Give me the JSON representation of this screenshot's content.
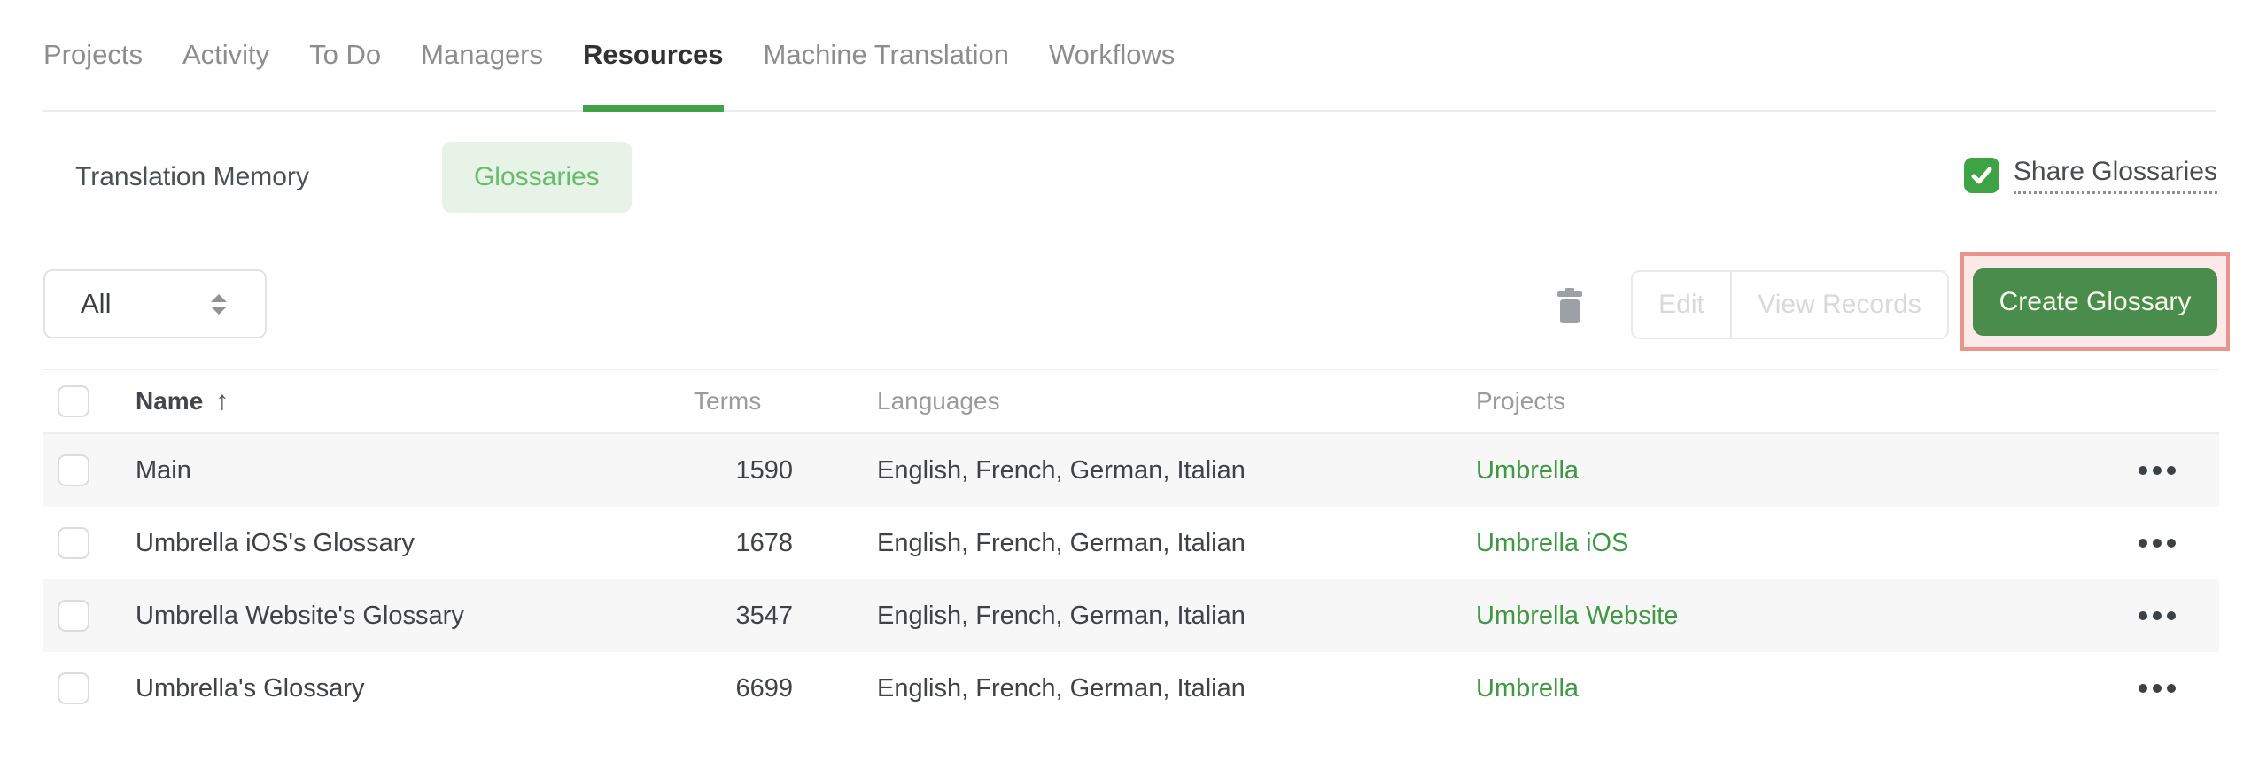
{
  "nav": {
    "tabs": [
      {
        "label": "Projects",
        "active": false
      },
      {
        "label": "Activity",
        "active": false
      },
      {
        "label": "To Do",
        "active": false
      },
      {
        "label": "Managers",
        "active": false
      },
      {
        "label": "Resources",
        "active": true
      },
      {
        "label": "Machine Translation",
        "active": false
      },
      {
        "label": "Workflows",
        "active": false
      }
    ]
  },
  "subtabs": {
    "translation_memory": "Translation Memory",
    "glossaries": "Glossaries"
  },
  "share": {
    "label": "Share Glossaries",
    "checked": true
  },
  "toolbar": {
    "filter_value": "All",
    "edit_label": "Edit",
    "view_records_label": "View Records",
    "create_label": "Create Glossary"
  },
  "icons": {
    "sort_ascending": "↑"
  },
  "table": {
    "header": {
      "name": "Name",
      "terms": "Terms",
      "languages": "Languages",
      "projects": "Projects"
    },
    "rows": [
      {
        "name": "Main",
        "terms": "1590",
        "languages": "English, French, German, Italian",
        "project": "Umbrella"
      },
      {
        "name": "Umbrella iOS's Glossary",
        "terms": "1678",
        "languages": "English, French, German, Italian",
        "project": "Umbrella iOS"
      },
      {
        "name": "Umbrella Website's Glossary",
        "terms": "3547",
        "languages": "English, French, German, Italian",
        "project": "Umbrella Website"
      },
      {
        "name": "Umbrella's Glossary",
        "terms": "6699",
        "languages": "English, French, German, Italian",
        "project": "Umbrella"
      }
    ]
  },
  "colors": {
    "accent-green": "#42a246",
    "check-green": "#3da345",
    "link-green": "#3f9844",
    "pill-bg": "#e8f3e8",
    "pill-text": "#69bb6d",
    "btn-green": "#4a8c4b",
    "btn-text": "#f6f8ec",
    "annotation-border": "#e9958e",
    "annotation-fill": "#fceae8",
    "stripe": "#f7f7f8",
    "divider": "#ececec"
  }
}
